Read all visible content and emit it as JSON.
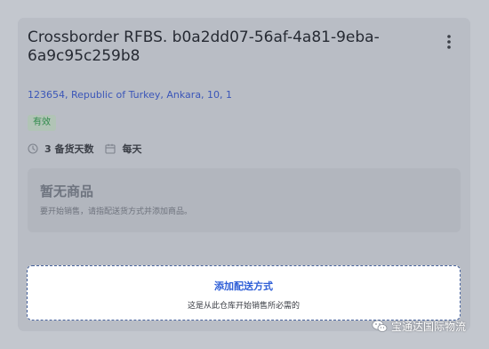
{
  "warehouse": {
    "title": "Crossborder RFBS. b0a2dd07-56af-4a81-9eba-6a9c95c259b8",
    "address": "123654, Republic of Turkey, Ankara, 10, 1",
    "status_badge": "有效",
    "prep_days": "3 备货天数",
    "schedule": "每天",
    "menu_icon": "more-vertical-icon"
  },
  "empty_state": {
    "heading": "暂无商品",
    "description": "要开始销售，请指配送货方式并添加商品。"
  },
  "add_delivery": {
    "label": "添加配送方式",
    "hint": "这是从此仓库开始销售所必需的"
  },
  "watermark": {
    "text": "宝通达国际物流"
  },
  "colors": {
    "page_bg": "#c3c7ce",
    "card_bg": "#b9bdc5",
    "link_blue": "#3b56b8",
    "accent_blue": "#2f5fd7",
    "status_green": "#2f8a4b"
  }
}
